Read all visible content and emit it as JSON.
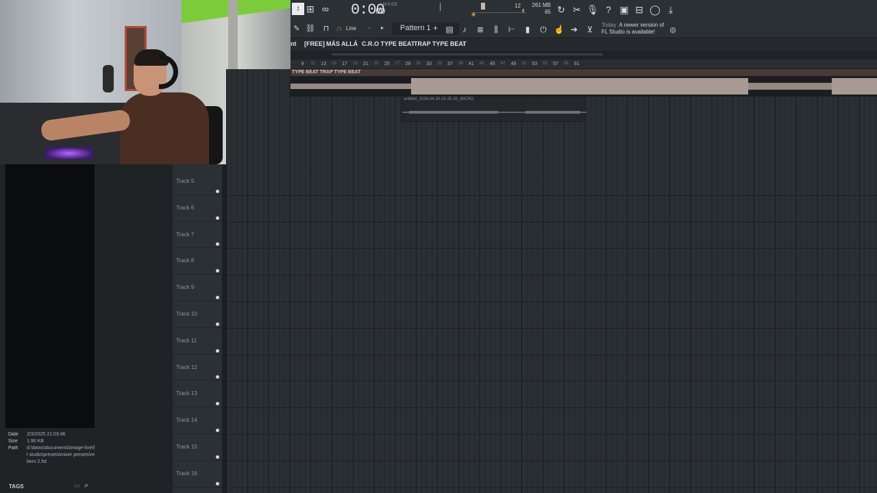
{
  "toolbar": {
    "time": "0:00",
    "time_small": "00",
    "time_unit": "M:S:CS",
    "tempo_val": "12",
    "mem_mb": "261 MB",
    "mem_val": "65",
    "snap": "Line",
    "pattern": "Pattern 1",
    "news_today": "Today",
    "news_text1": "A newer version of",
    "news_text2": "FL Studio is available!"
  },
  "breadcrumb": [
    "nt",
    "[FREE]",
    "MÁS ALLÁ",
    "C.R.O TYPE BEAT",
    "TRAP TYPE BEAT",
    "›"
  ],
  "ruler": {
    "major": [
      "9",
      "13",
      "17",
      "21",
      "25",
      "29",
      "33",
      "37",
      "41",
      "45",
      "49",
      "53",
      "57",
      "61"
    ],
    "minor": [
      "11",
      "15",
      "19",
      "23",
      "27",
      "31",
      "35",
      "39",
      "43",
      "47",
      "51",
      "55",
      "59"
    ]
  },
  "clip_top": "TYPE BEAT  TRAP TYPE BEAT",
  "clip2": "untitled_2026-04-20 22-25-30_MICRO",
  "tracks": [
    "Track 5",
    "Track 6",
    "Track 7",
    "Track 8",
    "Track 9",
    "Track 10",
    "Track 11",
    "Track 12",
    "Track 13",
    "Track 14",
    "Track 15",
    "Track 16"
  ],
  "info": {
    "date_key": "Date",
    "date_val": "2/3/2025 21:03:46",
    "size_key": "Size",
    "size_val": "1.90 KB",
    "path_key": "Path",
    "path_val": "d:\\datos\\documents\\image-line\\fl studio\\presets\\mixer presets\\reberv 2.fst"
  },
  "tags": "TAGS"
}
